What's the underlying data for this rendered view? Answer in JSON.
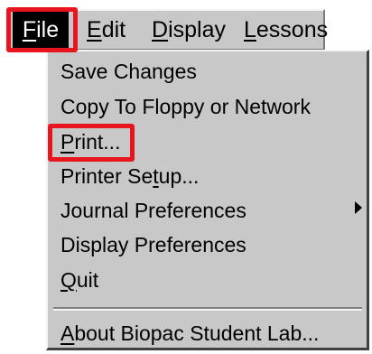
{
  "menubar": {
    "file": {
      "pre": "",
      "u": "F",
      "post": "ile"
    },
    "edit": {
      "pre": "",
      "u": "E",
      "post": "dit"
    },
    "display": {
      "pre": "",
      "u": "D",
      "post": "isplay"
    },
    "lessons": {
      "pre": "",
      "u": "L",
      "post": "essons"
    }
  },
  "menu": {
    "items": [
      {
        "label": "Save Changes"
      },
      {
        "label": "Copy To Floppy or Network"
      },
      {
        "pre": "",
        "u": "P",
        "post": "rint..."
      },
      {
        "pre": "Printer Se",
        "u": "t",
        "post": "up..."
      },
      {
        "label": "Journal Preferences"
      },
      {
        "label": "Display Preferences"
      },
      {
        "pre": "",
        "u": "Q",
        "post": "uit"
      },
      {
        "pre": "",
        "u": "A",
        "post": "bout Biopac Student Lab..."
      }
    ]
  },
  "colors": {
    "highlight": "#e8141e",
    "menu_bg": "#c8c8c8",
    "active_bg": "#000000"
  },
  "icons": {
    "submenu": "chevron-right-icon"
  }
}
